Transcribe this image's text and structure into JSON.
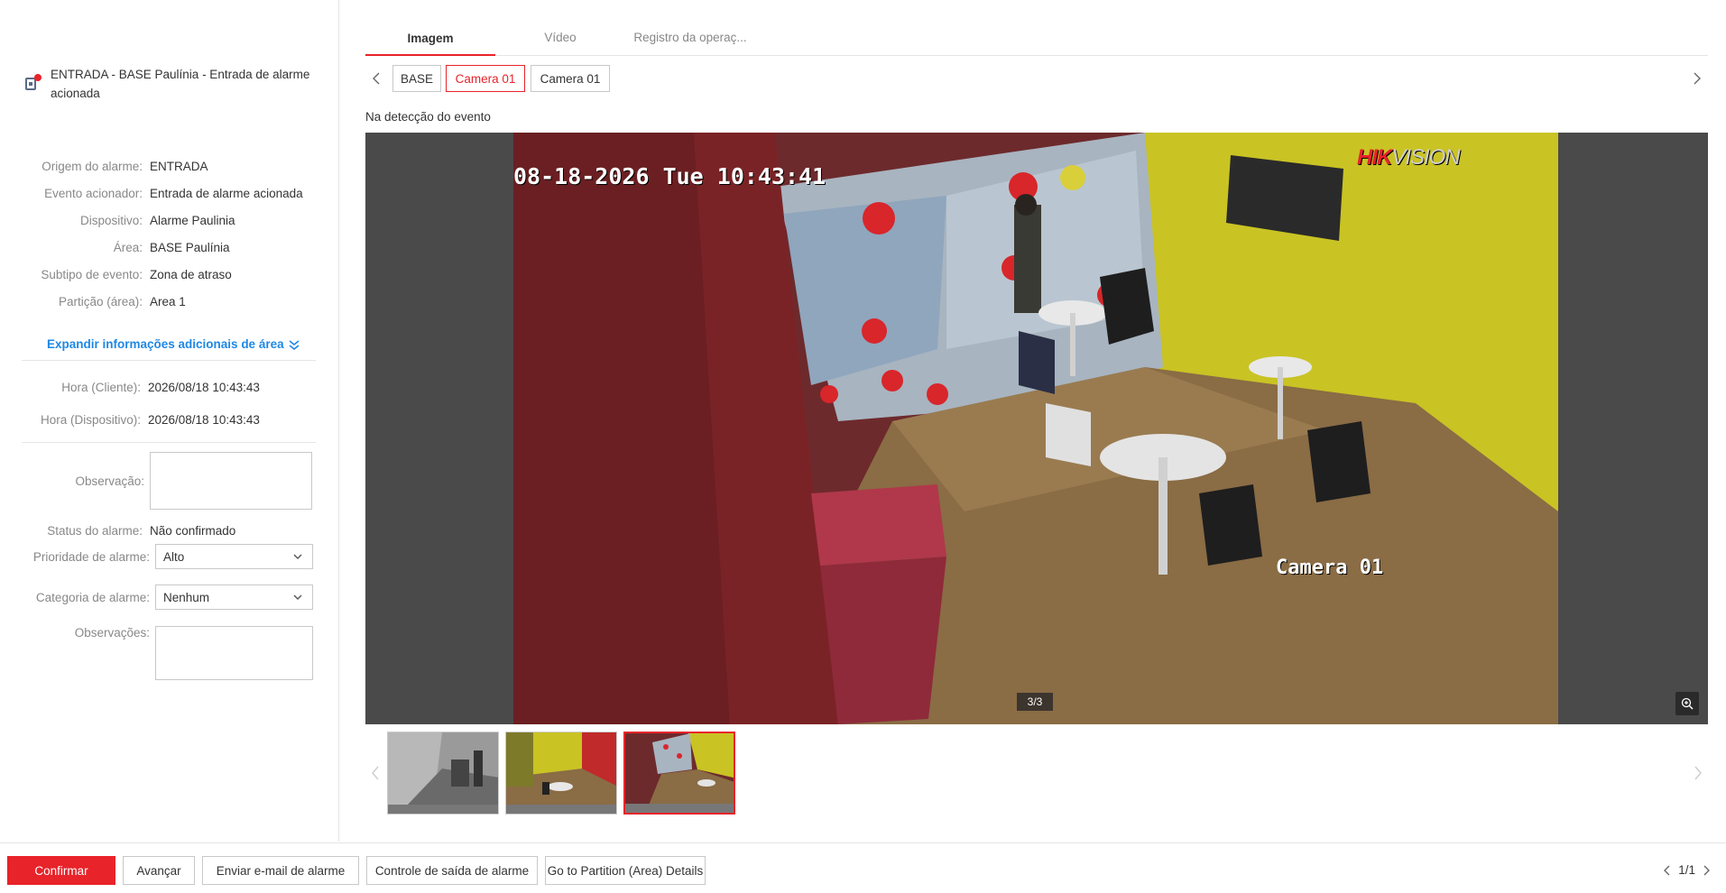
{
  "alarm": {
    "title": "ENTRADA - BASE Paulínia - Entrada de alarme acionada"
  },
  "details": [
    {
      "label": "Origem do alarme:",
      "value": "ENTRADA"
    },
    {
      "label": "Evento acionador:",
      "value": "Entrada de alarme acionada"
    },
    {
      "label": "Dispositivo:",
      "value": "Alarme Paulinia"
    },
    {
      "label": "Área:",
      "value": "BASE Paulínia"
    },
    {
      "label": "Subtipo de evento:",
      "value": "Zona de atraso"
    },
    {
      "label": "Partição (área):",
      "value": "Area 1"
    }
  ],
  "expand_link": "Expandir informações adicionais de área",
  "times": [
    {
      "label": "Hora (Cliente):",
      "value": "2026/08/18 10:43:43"
    },
    {
      "label": "Hora (Dispositivo):",
      "value": "2026/08/18 10:43:43"
    }
  ],
  "form": {
    "observation_label": "Observação:",
    "status_label": "Status do alarme:",
    "status_value": "Não confirmado",
    "priority_label": "Prioridade de alarme:",
    "priority_value": "Alto",
    "category_label": "Categoria de alarme:",
    "category_value": "Nenhum",
    "remarks_label": "Observações:"
  },
  "tabs": [
    "Imagem",
    "Vídeo",
    "Registro da operaç..."
  ],
  "camera_chips": [
    "BASE",
    "Camera 01",
    "Camera 01"
  ],
  "caption": "Na detecção do evento",
  "viewer": {
    "osd_time": "08-18-2026 Tue 10:43:41",
    "osd_camera": "Camera 01",
    "brand_a": "HIK",
    "brand_b": "VISION",
    "counter": "3/3"
  },
  "buttons": {
    "confirm": "Confirmar",
    "next": "Avançar",
    "email": "Enviar e-mail de alarme",
    "exit_control": "Controle de saída de alarme",
    "partition_details": "Go to Partition (Area) Details"
  },
  "pager": "1/1",
  "colors": {
    "accent": "#e8232a",
    "link": "#1e88e5"
  }
}
